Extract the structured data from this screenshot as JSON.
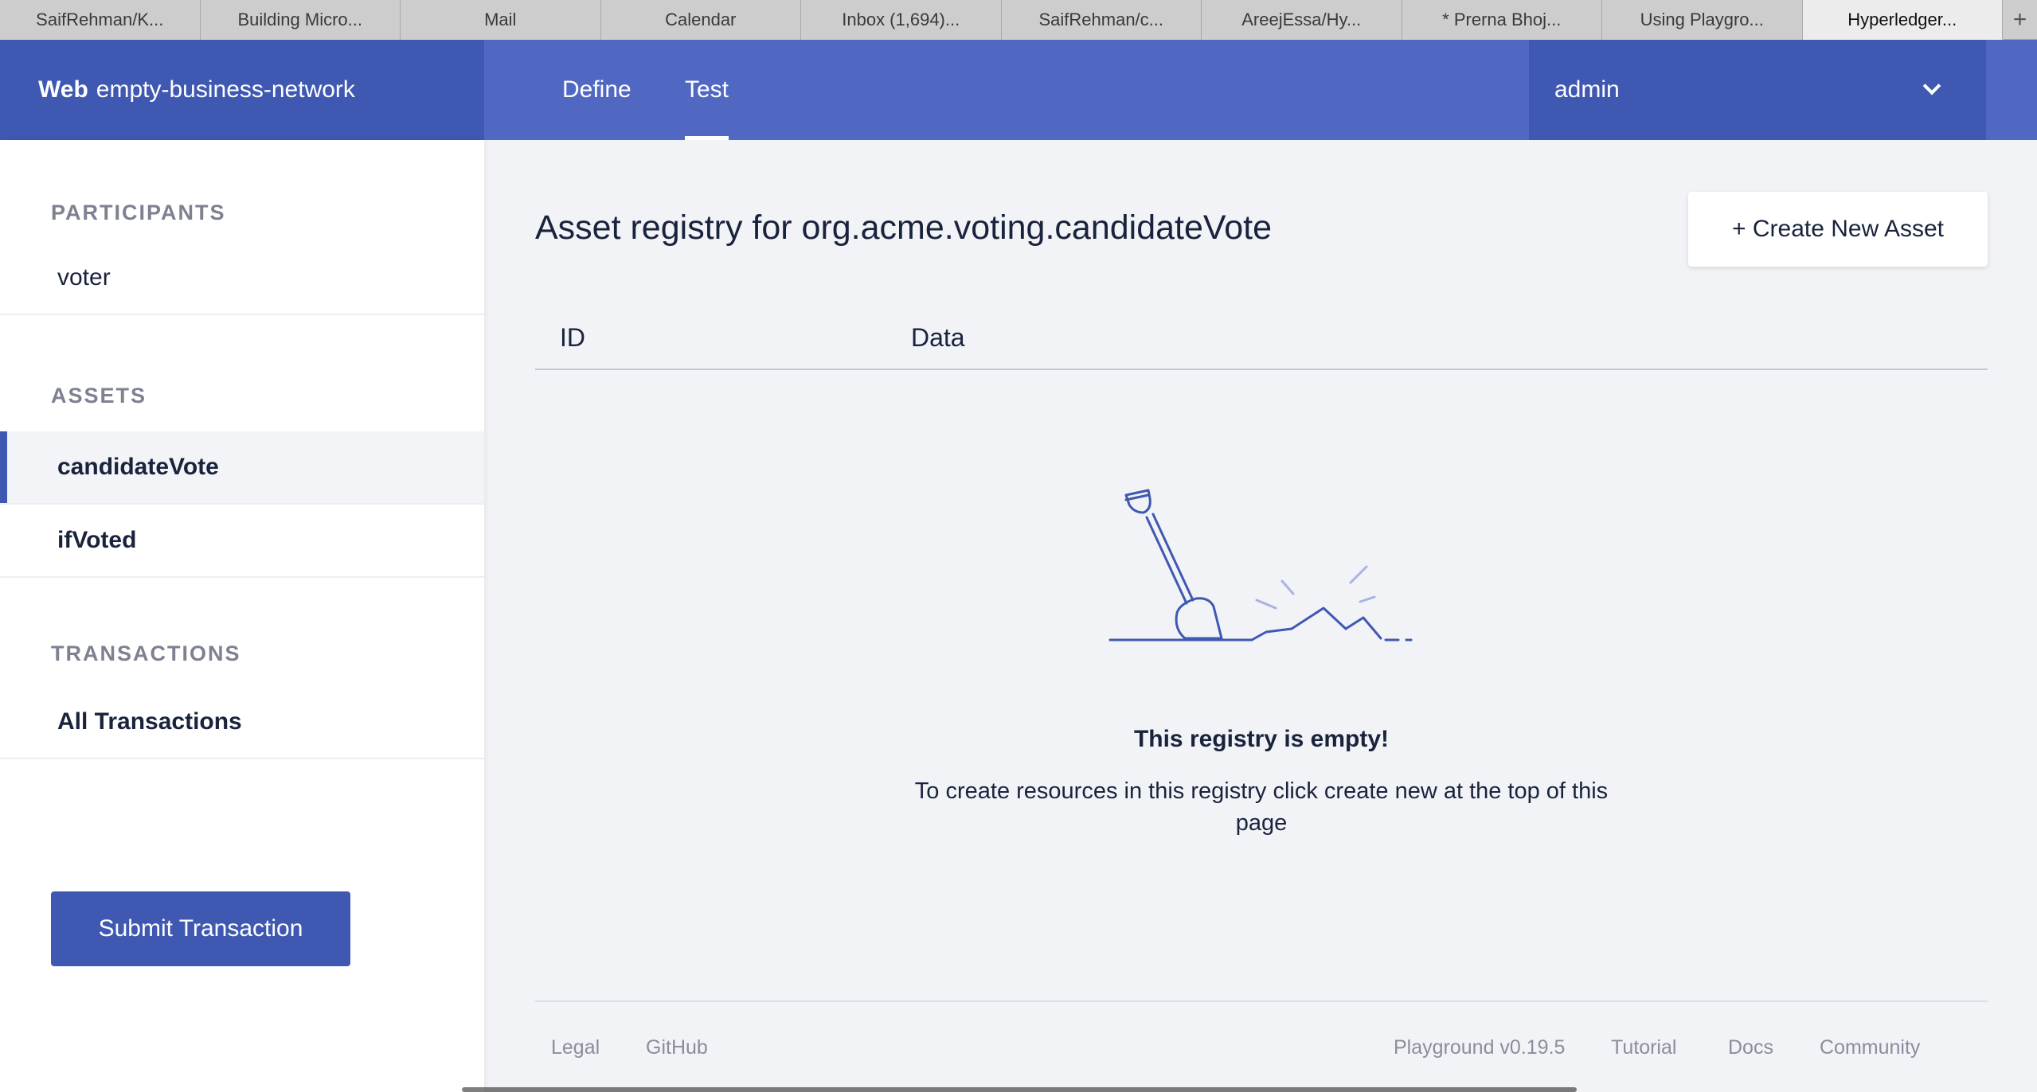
{
  "browser": {
    "tabs": [
      {
        "label": "SaifRehman/K..."
      },
      {
        "label": "Building Micro..."
      },
      {
        "label": "Mail"
      },
      {
        "label": "Calendar"
      },
      {
        "label": "Inbox (1,694)..."
      },
      {
        "label": "SaifRehman/c..."
      },
      {
        "label": "AreejEssa/Hy..."
      },
      {
        "label": "* Prerna Bhoj..."
      },
      {
        "label": "Using Playgro..."
      },
      {
        "label": "Hyperledger..."
      }
    ],
    "active_tab_index": 9,
    "add_tab_label": "+"
  },
  "header": {
    "brand_bold": "Web",
    "network_name": "empty-business-network",
    "nav": [
      {
        "label": "Define"
      },
      {
        "label": "Test"
      }
    ],
    "active_nav": "Test",
    "identity": "admin",
    "colors": {
      "header": "#5068c2",
      "brand": "#3f58b1"
    }
  },
  "sidebar": {
    "participants_title": "PARTICIPANTS",
    "participants": [
      {
        "label": "voter"
      }
    ],
    "assets_title": "ASSETS",
    "assets": [
      {
        "label": "candidateVote"
      },
      {
        "label": "ifVoted"
      }
    ],
    "selected_asset": "candidateVote",
    "transactions_title": "TRANSACTIONS",
    "transactions": [
      {
        "label": "All Transactions"
      }
    ],
    "submit_label": "Submit Transaction"
  },
  "main": {
    "title": "Asset registry for org.acme.voting.candidateVote",
    "create_label": "+ Create New Asset",
    "columns": [
      "ID",
      "Data"
    ],
    "empty_title": "This registry is empty!",
    "empty_desc": "To create resources in this registry click create new at the top of this page"
  },
  "footer": {
    "legal": "Legal",
    "github": "GitHub",
    "version": "Playground v0.19.5",
    "tutorial": "Tutorial",
    "docs": "Docs",
    "community": "Community"
  }
}
